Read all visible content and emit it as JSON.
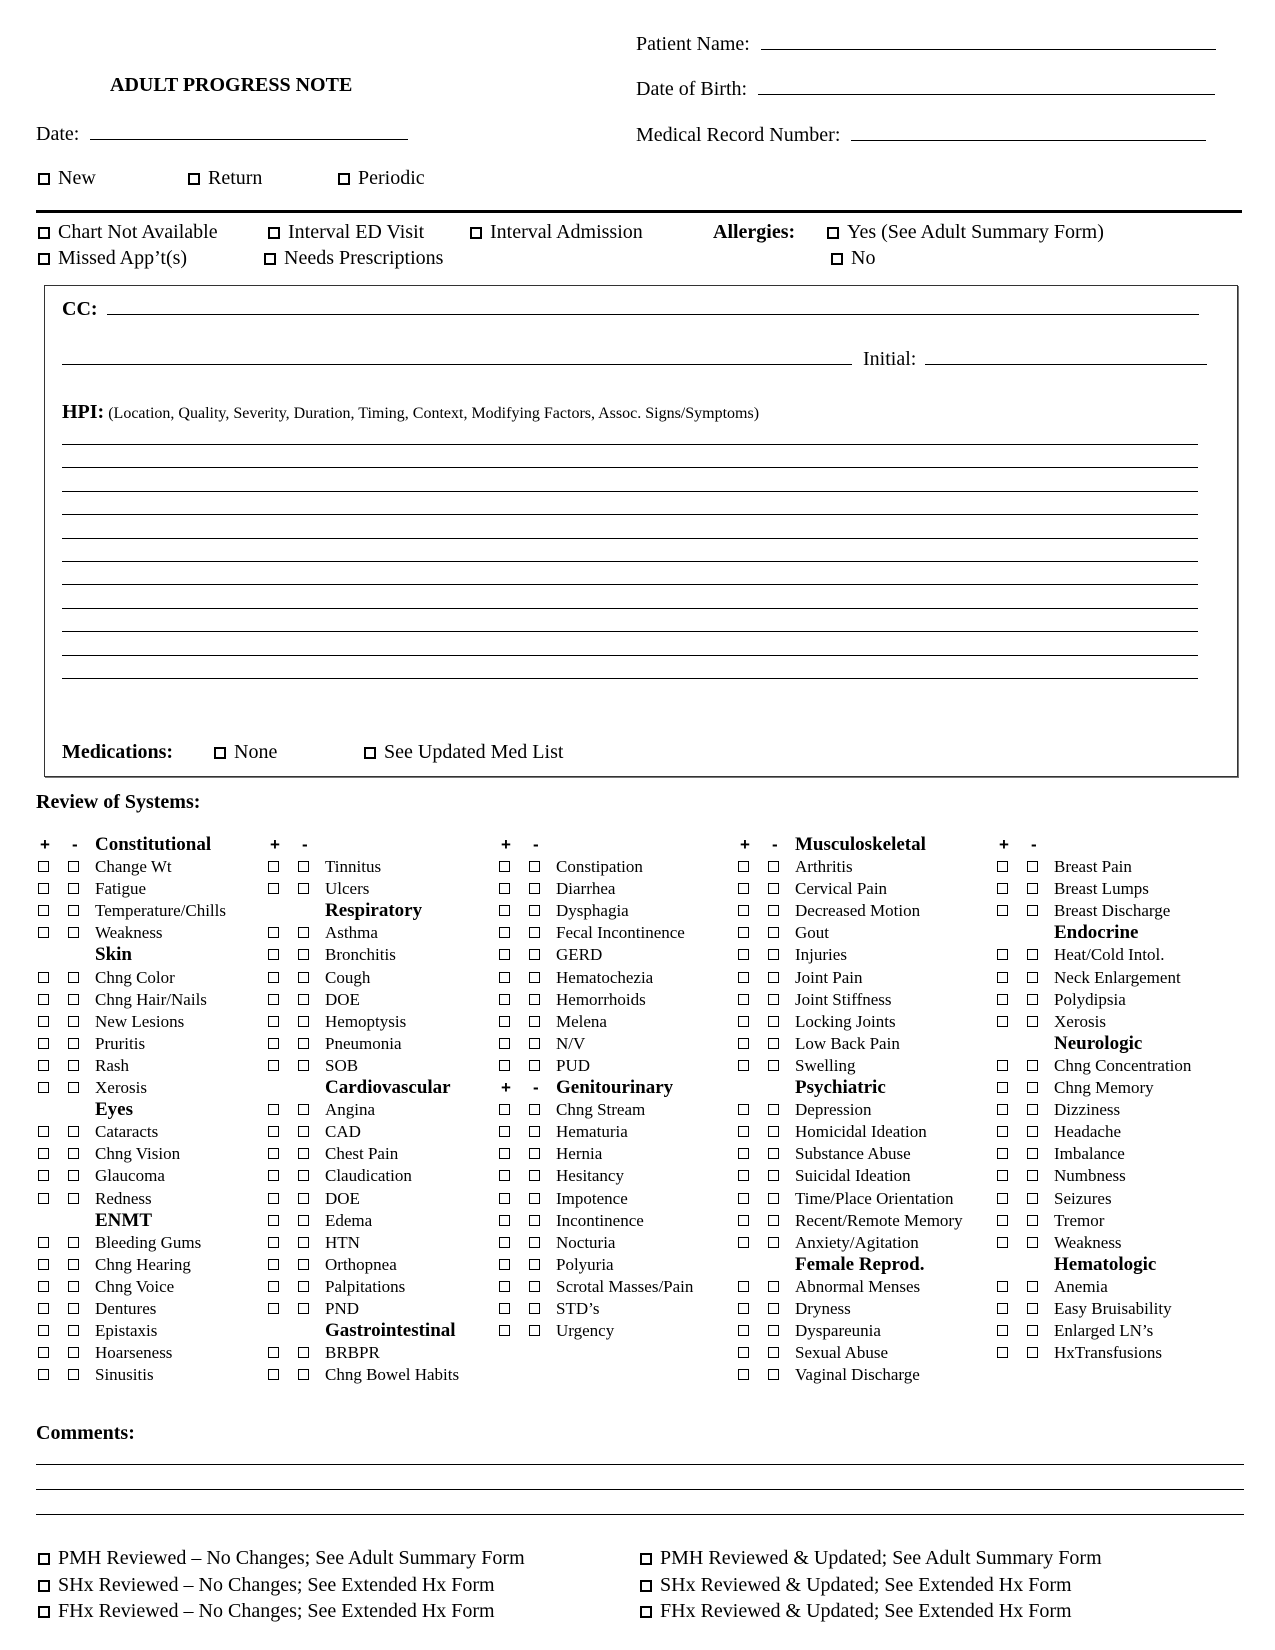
{
  "header": {
    "title": "ADULT PROGRESS NOTE",
    "date_label": "Date:",
    "patient_name_label": "Patient Name:",
    "dob_label": "Date of Birth:",
    "mrn_label": "Medical Record Number:",
    "visit_types": [
      "New",
      "Return",
      "Periodic"
    ]
  },
  "status_options": {
    "row1": [
      "Chart Not Available",
      "Interval ED Visit",
      "Interval Admission"
    ],
    "row2": [
      "Missed App’t(s)",
      "Needs Prescriptions"
    ],
    "allergies_label": "Allergies:",
    "allergies_options": [
      "Yes (See Adult Summary Form)",
      "No"
    ]
  },
  "clinical_box": {
    "cc_label": "CC:",
    "initial_label": "Initial:",
    "hpi_label": "HPI:",
    "hpi_hint": "(Location, Quality, Severity, Duration, Timing, Context, Modifying Factors, Assoc. Signs/Symptoms)",
    "hpi_line_count": 11,
    "medications_label": "Medications:",
    "medications_options": [
      "None",
      "See Updated Med List"
    ]
  },
  "ros": {
    "title": "Review of Systems:",
    "plus": "+",
    "minus": "-",
    "columns": [
      [
        {
          "type": "pm",
          "label": "Constitutional"
        },
        {
          "type": "item",
          "label": "Change Wt"
        },
        {
          "type": "item",
          "label": "Fatigue"
        },
        {
          "type": "item",
          "label": "Temperature/Chills"
        },
        {
          "type": "item",
          "label": "Weakness"
        },
        {
          "type": "header",
          "label": "Skin"
        },
        {
          "type": "item",
          "label": "Chng Color"
        },
        {
          "type": "item",
          "label": "Chng Hair/Nails"
        },
        {
          "type": "item",
          "label": "New Lesions"
        },
        {
          "type": "item",
          "label": "Pruritis"
        },
        {
          "type": "item",
          "label": "Rash"
        },
        {
          "type": "item",
          "label": "Xerosis"
        },
        {
          "type": "header",
          "label": "Eyes"
        },
        {
          "type": "item",
          "label": "Cataracts"
        },
        {
          "type": "item",
          "label": "Chng Vision"
        },
        {
          "type": "item",
          "label": "Glaucoma"
        },
        {
          "type": "item",
          "label": "Redness"
        },
        {
          "type": "header",
          "label": "ENMT"
        },
        {
          "type": "item",
          "label": "Bleeding Gums"
        },
        {
          "type": "item",
          "label": "Chng Hearing"
        },
        {
          "type": "item",
          "label": "Chng Voice"
        },
        {
          "type": "item",
          "label": "Dentures"
        },
        {
          "type": "item",
          "label": "Epistaxis"
        },
        {
          "type": "item",
          "label": "Hoarseness"
        },
        {
          "type": "item",
          "label": "Sinusitis"
        }
      ],
      [
        {
          "type": "pm",
          "label": ""
        },
        {
          "type": "item",
          "label": "Tinnitus"
        },
        {
          "type": "item",
          "label": "Ulcers"
        },
        {
          "type": "header",
          "label": "Respiratory"
        },
        {
          "type": "item",
          "label": "Asthma"
        },
        {
          "type": "item",
          "label": "Bronchitis"
        },
        {
          "type": "item",
          "label": "Cough"
        },
        {
          "type": "item",
          "label": "DOE"
        },
        {
          "type": "item",
          "label": "Hemoptysis"
        },
        {
          "type": "item",
          "label": "Pneumonia"
        },
        {
          "type": "item",
          "label": "SOB"
        },
        {
          "type": "header",
          "label": "Cardiovascular"
        },
        {
          "type": "item",
          "label": "Angina"
        },
        {
          "type": "item",
          "label": "CAD"
        },
        {
          "type": "item",
          "label": "Chest Pain"
        },
        {
          "type": "item",
          "label": "Claudication"
        },
        {
          "type": "item",
          "label": "DOE"
        },
        {
          "type": "item",
          "label": "Edema"
        },
        {
          "type": "item",
          "label": "HTN"
        },
        {
          "type": "item",
          "label": "Orthopnea"
        },
        {
          "type": "item",
          "label": "Palpitations"
        },
        {
          "type": "item",
          "label": "PND"
        },
        {
          "type": "header",
          "label": "Gastrointestinal"
        },
        {
          "type": "item",
          "label": "BRBPR"
        },
        {
          "type": "item",
          "label": "Chng Bowel Habits"
        }
      ],
      [
        {
          "type": "pm",
          "label": ""
        },
        {
          "type": "item",
          "label": "Constipation"
        },
        {
          "type": "item",
          "label": "Diarrhea"
        },
        {
          "type": "item",
          "label": "Dysphagia"
        },
        {
          "type": "item",
          "label": "Fecal Incontinence"
        },
        {
          "type": "item",
          "label": "GERD"
        },
        {
          "type": "item",
          "label": "Hematochezia"
        },
        {
          "type": "item",
          "label": "Hemorrhoids"
        },
        {
          "type": "item",
          "label": "Melena"
        },
        {
          "type": "item",
          "label": "N/V"
        },
        {
          "type": "item",
          "label": "PUD"
        },
        {
          "type": "pm",
          "label": "Genitourinary"
        },
        {
          "type": "item",
          "label": "Chng Stream"
        },
        {
          "type": "item",
          "label": "Hematuria"
        },
        {
          "type": "item",
          "label": "Hernia"
        },
        {
          "type": "item",
          "label": "Hesitancy"
        },
        {
          "type": "item",
          "label": "Impotence"
        },
        {
          "type": "item",
          "label": "Incontinence"
        },
        {
          "type": "item",
          "label": "Nocturia"
        },
        {
          "type": "item",
          "label": "Polyuria"
        },
        {
          "type": "item",
          "label": "Scrotal Masses/Pain"
        },
        {
          "type": "item",
          "label": "STD’s"
        },
        {
          "type": "item",
          "label": "Urgency"
        }
      ],
      [
        {
          "type": "pm",
          "label": "Musculoskeletal"
        },
        {
          "type": "item",
          "label": "Arthritis"
        },
        {
          "type": "item",
          "label": "Cervical Pain"
        },
        {
          "type": "item",
          "label": "Decreased Motion"
        },
        {
          "type": "item",
          "label": "Gout"
        },
        {
          "type": "item",
          "label": "Injuries"
        },
        {
          "type": "item",
          "label": "Joint Pain"
        },
        {
          "type": "item",
          "label": "Joint Stiffness"
        },
        {
          "type": "item",
          "label": "Locking Joints"
        },
        {
          "type": "item",
          "label": "Low Back Pain"
        },
        {
          "type": "item",
          "label": "Swelling"
        },
        {
          "type": "header",
          "label": "Psychiatric"
        },
        {
          "type": "item",
          "label": "Depression"
        },
        {
          "type": "item",
          "label": "Homicidal Ideation"
        },
        {
          "type": "item",
          "label": "Substance Abuse"
        },
        {
          "type": "item",
          "label": "Suicidal Ideation"
        },
        {
          "type": "item",
          "label": "Time/Place Orientation"
        },
        {
          "type": "item",
          "label": "Recent/Remote Memory"
        },
        {
          "type": "item",
          "label": "Anxiety/Agitation"
        },
        {
          "type": "header",
          "label": "Female Reprod."
        },
        {
          "type": "item",
          "label": "Abnormal Menses"
        },
        {
          "type": "item",
          "label": "Dryness"
        },
        {
          "type": "item",
          "label": "Dyspareunia"
        },
        {
          "type": "item",
          "label": "Sexual Abuse"
        },
        {
          "type": "item",
          "label": "Vaginal Discharge"
        }
      ],
      [
        {
          "type": "pm",
          "label": ""
        },
        {
          "type": "item",
          "label": "Breast Pain"
        },
        {
          "type": "item",
          "label": "Breast Lumps"
        },
        {
          "type": "item",
          "label": "Breast Discharge"
        },
        {
          "type": "header",
          "label": "Endocrine"
        },
        {
          "type": "item",
          "label": "Heat/Cold Intol."
        },
        {
          "type": "item",
          "label": "Neck Enlargement"
        },
        {
          "type": "item",
          "label": "Polydipsia"
        },
        {
          "type": "item",
          "label": "Xerosis"
        },
        {
          "type": "header",
          "label": "Neurologic"
        },
        {
          "type": "item",
          "label": "Chng Concentration"
        },
        {
          "type": "item",
          "label": "Chng Memory"
        },
        {
          "type": "item",
          "label": "Dizziness"
        },
        {
          "type": "item",
          "label": "Headache"
        },
        {
          "type": "item",
          "label": "Imbalance"
        },
        {
          "type": "item",
          "label": "Numbness"
        },
        {
          "type": "item",
          "label": "Seizures"
        },
        {
          "type": "item",
          "label": "Tremor"
        },
        {
          "type": "item",
          "label": "Weakness"
        },
        {
          "type": "header",
          "label": "Hematologic"
        },
        {
          "type": "item",
          "label": "Anemia"
        },
        {
          "type": "item",
          "label": "Easy Bruisability"
        },
        {
          "type": "item",
          "label": "Enlarged LN’s"
        },
        {
          "type": "item",
          "label": "HxTransfusions"
        }
      ]
    ]
  },
  "comments": {
    "label": "Comments:",
    "line_count": 3
  },
  "history_review": {
    "left": [
      "PMH Reviewed – No Changes; See Adult Summary Form",
      "SHx Reviewed – No Changes; See Extended Hx Form",
      "FHx Reviewed – No Changes; See Extended Hx Form"
    ],
    "right": [
      "PMH Reviewed & Updated; See Adult Summary Form",
      "SHx Reviewed & Updated; See Extended Hx Form",
      "FHx Reviewed & Updated; See Extended Hx Form"
    ]
  }
}
